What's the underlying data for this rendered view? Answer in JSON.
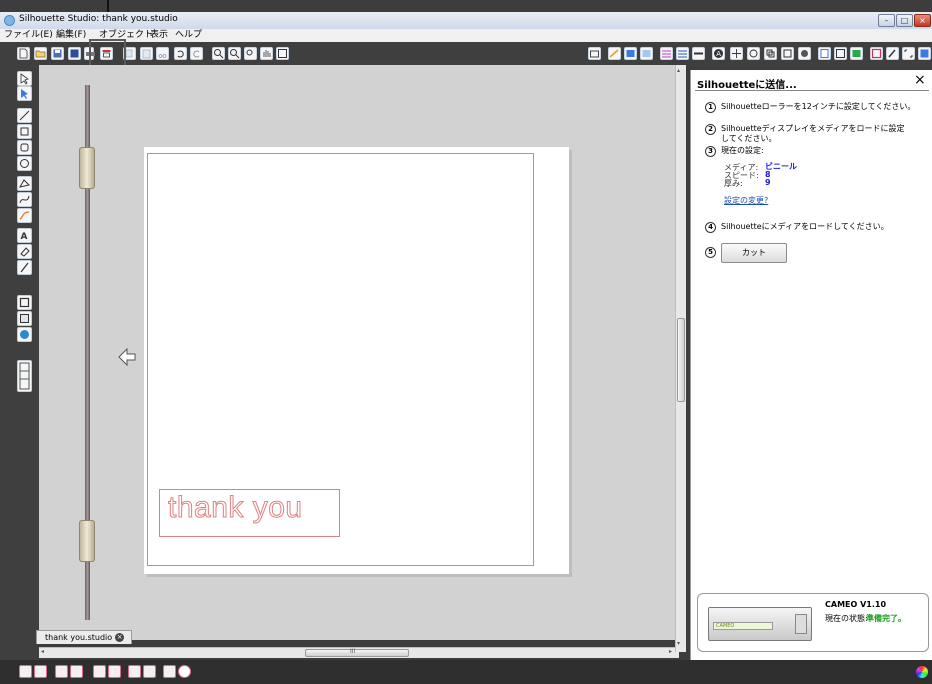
{
  "window": {
    "title": "Silhouette Studio: thank you.studio",
    "controls": {
      "minimize": "–",
      "maximize": "□",
      "close": "×"
    }
  },
  "menu": [
    "ファイル(E)",
    "編集(F)",
    "オブジェクト",
    "表示",
    "ヘルプ"
  ],
  "toolbar": {
    "left_icons": [
      "new-document-icon",
      "open-folder-icon",
      "save-icon",
      "save-to-library-icon",
      "print-icon",
      "cut-settings-icon",
      "copy-icon",
      "paste-icon",
      "cut-icon",
      "undo-icon",
      "redo-icon",
      "zoom-in-icon",
      "zoom-out-icon",
      "zoom-select-icon",
      "pan-icon",
      "fit-page-icon"
    ],
    "right_icons": [
      "send-to-silhouette-icon",
      "line-style-icon",
      "fill-color-icon",
      "gradient-icon",
      "fill-pattern-icon",
      "line-color-icon",
      "line-weight-icon",
      "text-style-icon",
      "transform-icon",
      "replicate-icon",
      "modify-icon",
      "offset-icon",
      "trace-icon",
      "page-setup-icon",
      "registration-marks-icon",
      "cut-settings-panel-icon",
      "library-icon",
      "sketch-icon",
      "grid-icon",
      "store-icon"
    ]
  },
  "left_tools": [
    "select-icon",
    "edit-points-icon",
    "line-icon",
    "rectangle-icon",
    "rounded-rectangle-icon",
    "ellipse-icon",
    "polygon-icon",
    "curve-icon",
    "freehand-icon",
    "text-icon",
    "eraser-icon",
    "knife-icon",
    "show-library-icon",
    "show-store-icon",
    "silhouette-connect-icon",
    "grid-panel-icon"
  ],
  "canvas": {
    "design_text": "thank you",
    "document_tab": "thank you.studio",
    "tab_close": "×",
    "hscroll_grip": "III"
  },
  "send_panel": {
    "title": "Silhouetteに送信...",
    "close": "×",
    "steps": [
      {
        "num": "1",
        "text": "Silhouetteローラーを12インチに設定してください。"
      },
      {
        "num": "2",
        "text": "Silhouetteディスプレイをメディアをロードに設定してください。"
      },
      {
        "num": "3",
        "text": "現在の設定:"
      },
      {
        "num": "4",
        "text": "Silhouetteにメディアをロードしてください。"
      },
      {
        "num": "5",
        "text": ""
      }
    ],
    "settings": [
      {
        "label": "メディア:",
        "value": "ビニール"
      },
      {
        "label": "スピード:",
        "value": "8"
      },
      {
        "label": "厚み:",
        "value": "9"
      }
    ],
    "change_settings_link": "設定の変更?",
    "cut_button": "カット",
    "device": {
      "model": "CAMEO V1.10",
      "status_label": "現在の状態:",
      "status": "準備完了。",
      "brand": "CAMEO"
    }
  },
  "bottom_tools": [
    "group-icon",
    "ungroup-icon",
    "make-compound-icon",
    "release-compound-icon",
    "weld-icon",
    "delete-icon",
    "bring-forward-icon",
    "send-backward-icon",
    "lock-icon",
    "color-wheel-icon"
  ],
  "colors": {
    "cut_line": "#e08080",
    "status_ready": "#1aa01a",
    "setting_value": "#1a1adc"
  }
}
